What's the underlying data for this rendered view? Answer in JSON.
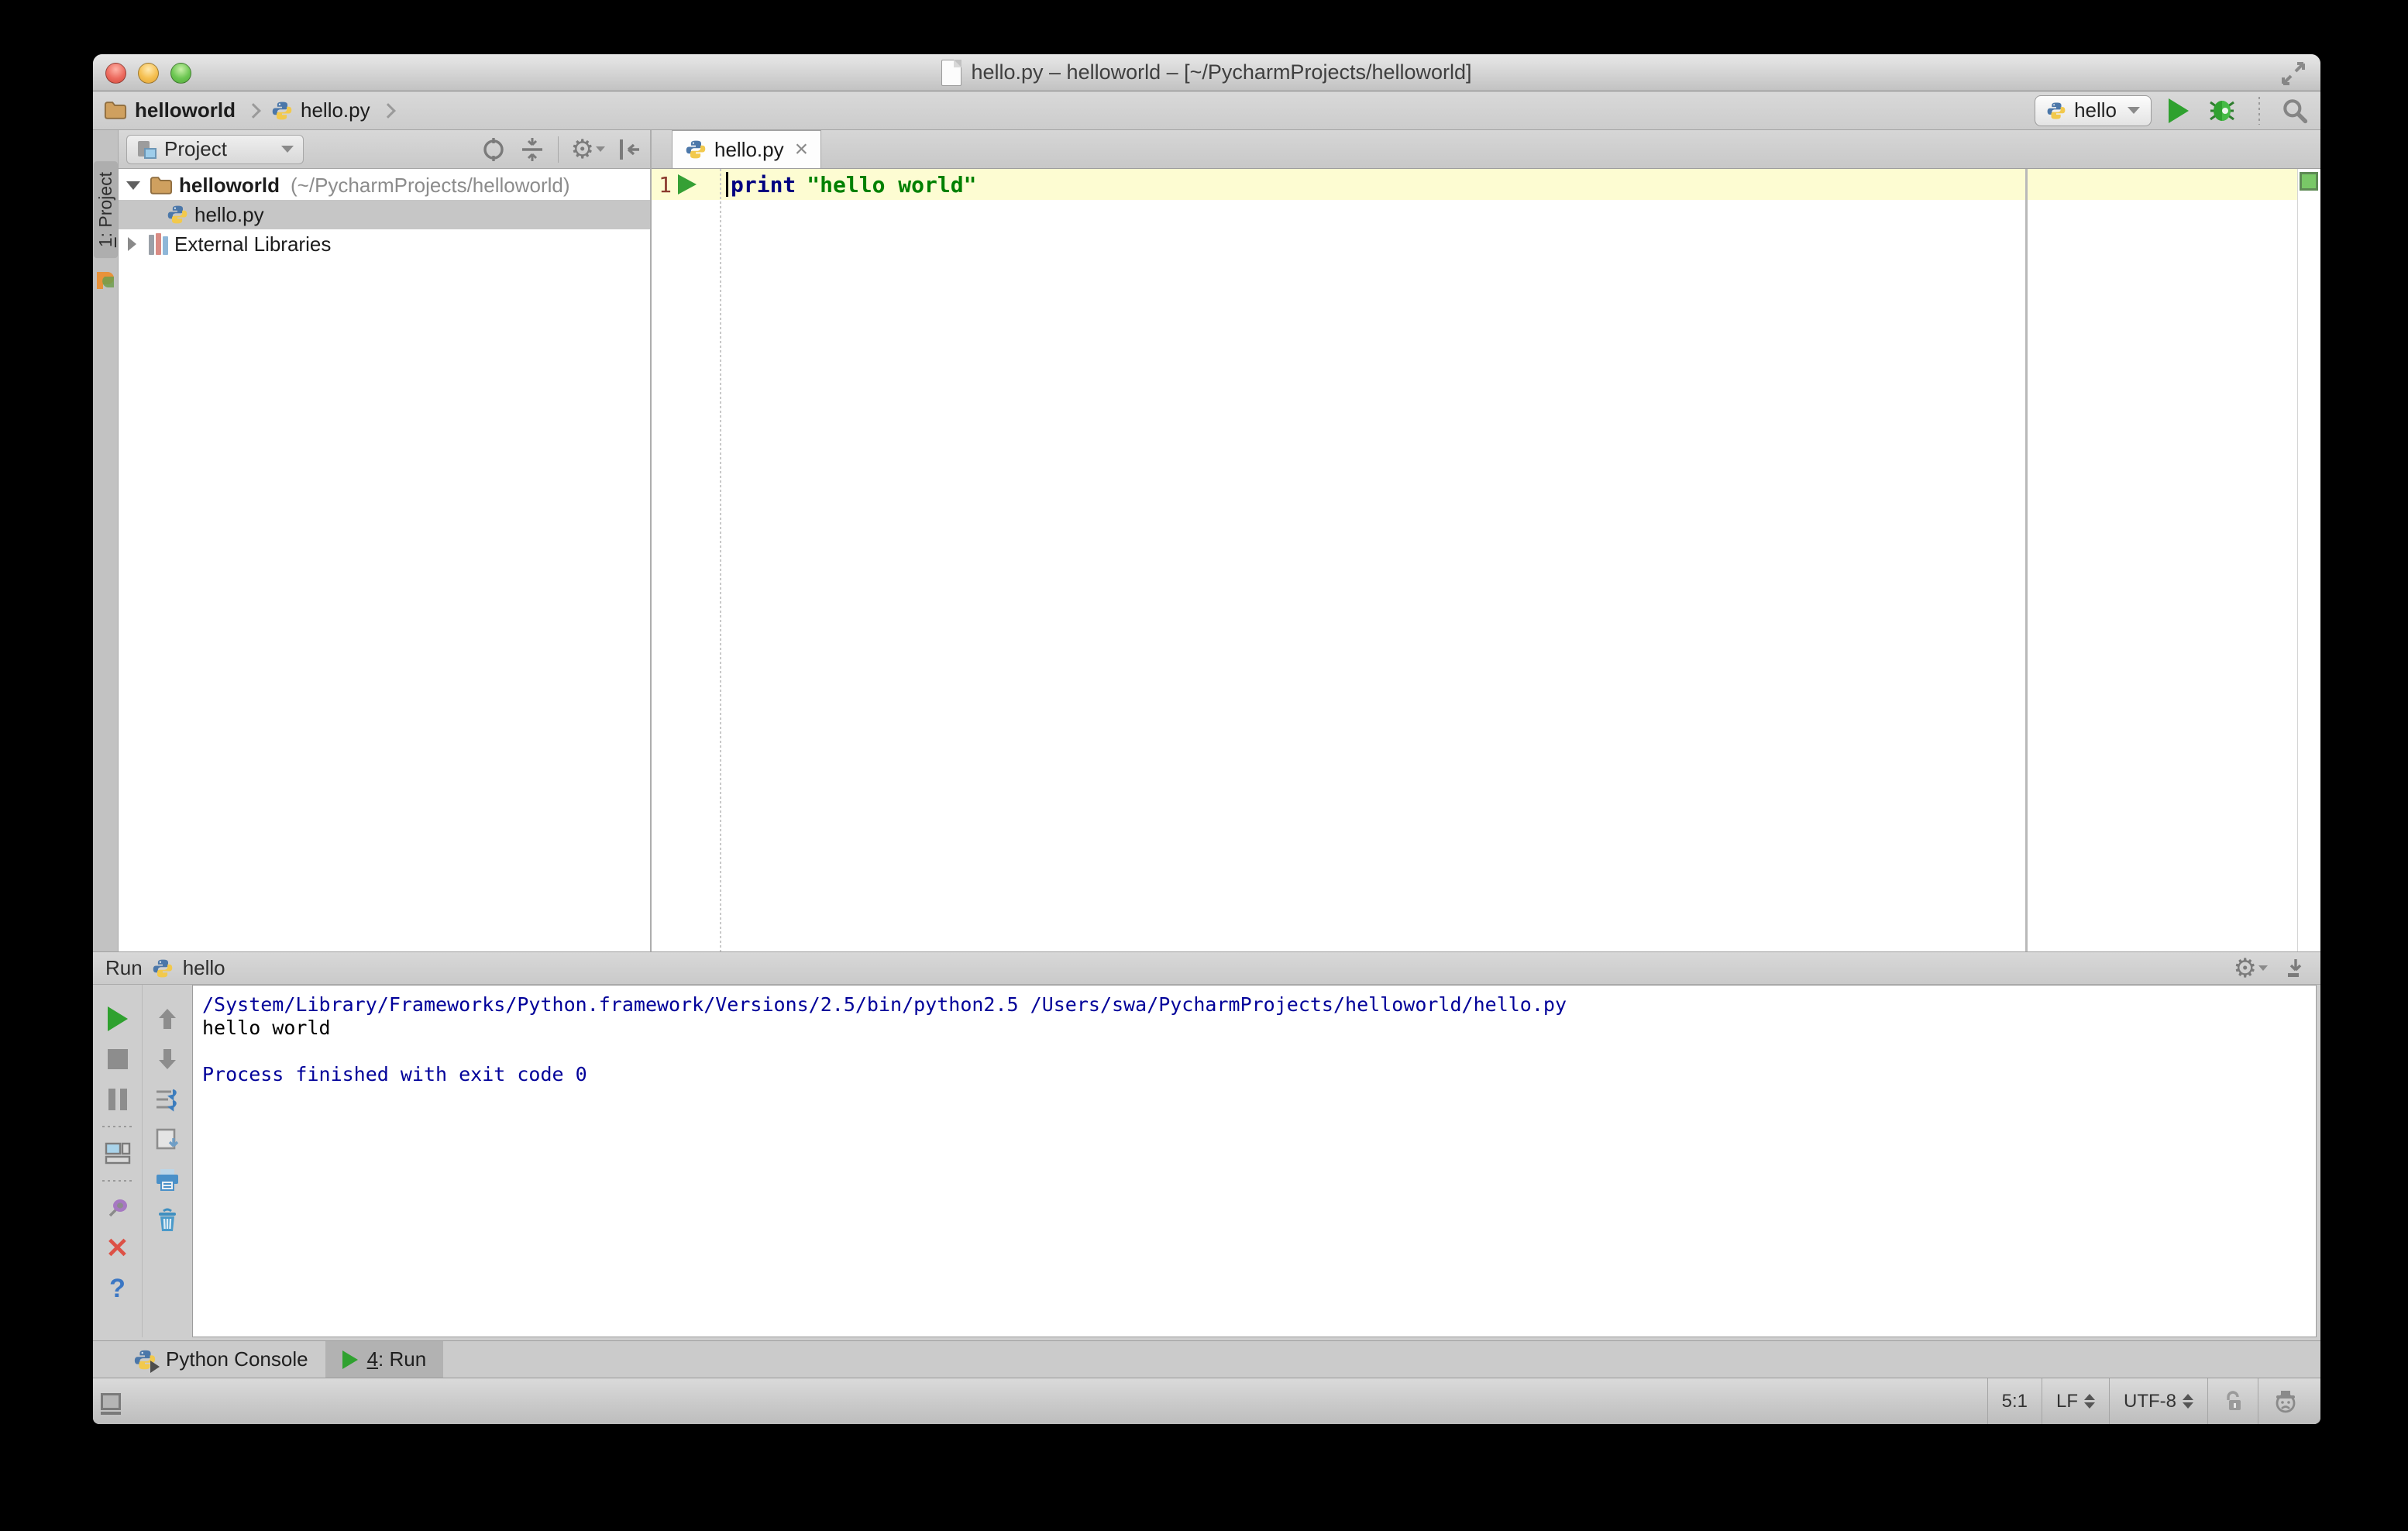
{
  "window": {
    "title": "hello.py – helloworld – [~/PycharmProjects/helloworld]"
  },
  "navbar": {
    "breadcrumb_project": "helloworld",
    "breadcrumb_file": "hello.py",
    "run_config_label": "hello"
  },
  "tool_stripe": {
    "project_tab_num": "1",
    "project_tab_label": ": Project"
  },
  "project_panel": {
    "header_label": "Project",
    "tree": {
      "root_label": "helloworld",
      "root_path": "(~/PycharmProjects/helloworld)",
      "file_label": "hello.py",
      "libs_label": "External Libraries"
    }
  },
  "editor": {
    "tab_label": "hello.py",
    "line_number": "1",
    "code_keyword": "print",
    "code_string": "\"hello world\""
  },
  "run_panel": {
    "title_label": "Run",
    "config_label": "hello",
    "console_line1": "/System/Library/Frameworks/Python.framework/Versions/2.5/bin/python2.5 /Users/swa/PycharmProjects/helloworld/hello.py",
    "console_line2": "hello world",
    "console_line4": "Process finished with exit code 0"
  },
  "bottom_bar": {
    "console_tab_label": "Python Console",
    "run_tab_num": "4",
    "run_tab_label": ": Run"
  },
  "status_bar": {
    "caret_position": "5:1",
    "line_separator": "LF",
    "encoding": "UTF-8"
  },
  "glyphs": {
    "tab_close": "×",
    "help": "?",
    "gear": "⚙",
    "close_run": "✕"
  },
  "colors": {
    "run_green": "#2fa12f",
    "keyword_blue": "#000080",
    "string_green": "#008000",
    "console_blue": "#000099",
    "inspection_ok_green": "#79c867",
    "current_line_yellow": "#fdfcd2",
    "selection_gray": "#c6c6c6"
  }
}
